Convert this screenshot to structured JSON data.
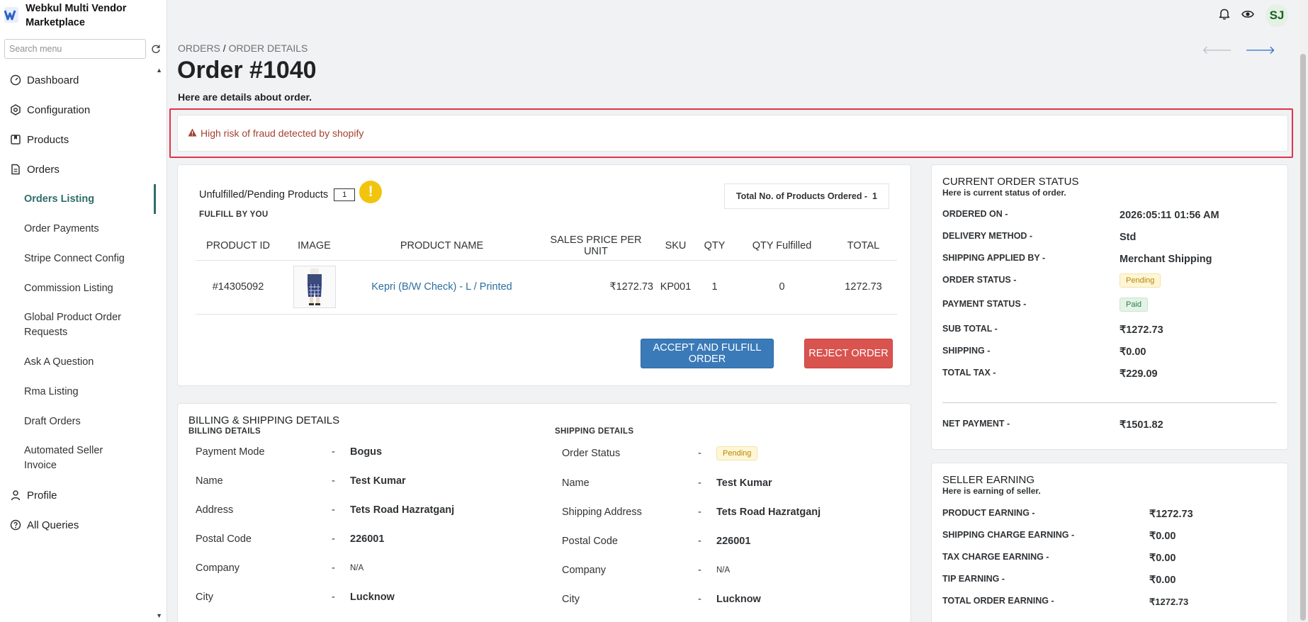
{
  "app": {
    "name": "Webkul Multi Vendor Marketplace"
  },
  "sidebar": {
    "search_placeholder": "Search menu",
    "items": [
      {
        "label": "Dashboard"
      },
      {
        "label": "Configuration"
      },
      {
        "label": "Products"
      },
      {
        "label": "Orders"
      }
    ],
    "orders_sub": [
      {
        "label": "Orders Listing"
      },
      {
        "label": "Order Payments"
      },
      {
        "label": "Stripe Connect Config"
      },
      {
        "label": "Commission Listing"
      },
      {
        "label": "Global Product Order Requests"
      },
      {
        "label": "Ask A Question"
      },
      {
        "label": "Rma Listing"
      },
      {
        "label": "Draft Orders"
      },
      {
        "label": "Automated Seller Invoice"
      }
    ],
    "bottom_items": [
      {
        "label": "Profile"
      },
      {
        "label": "All Queries"
      }
    ]
  },
  "topbar": {
    "avatar_initials": "SJ"
  },
  "breadcrumb": {
    "parent": "ORDERS",
    "separator": "/",
    "current": "ORDER DETAILS"
  },
  "page": {
    "title": "Order #1040",
    "subtitle": "Here are details about order."
  },
  "alert": {
    "text": "High risk of fraud detected by shopify"
  },
  "products_card": {
    "unfulfilled_label": "Unfulfilled/Pending Products",
    "unfulfilled_count": "1",
    "fulfill_by": "FULFILL BY YOU",
    "total_label": "Total No. of Products Ordered -",
    "total_value": "1",
    "columns": [
      "PRODUCT ID",
      "IMAGE",
      "PRODUCT NAME",
      "SALES PRICE PER UNIT",
      "SKU",
      "QTY",
      "QTY Fulfilled",
      "TOTAL"
    ],
    "rows": [
      {
        "product_id": "#14305092",
        "name": "Kepri (B/W Check) - L / Printed",
        "price": "₹1272.73",
        "sku": "KP001",
        "qty": "1",
        "qty_fulfilled": "0",
        "total": "1272.73"
      }
    ],
    "accept_label": "ACCEPT AND FULFILL ORDER",
    "reject_label": "REJECT ORDER"
  },
  "status_card": {
    "title": "CURRENT ORDER STATUS",
    "subtitle": "Here is current status of order.",
    "rows": [
      {
        "label": "ORDERED ON -",
        "value": "2026:05:11 01:56 AM"
      },
      {
        "label": "DELIVERY METHOD -",
        "value": "Std"
      },
      {
        "label": "SHIPPING APPLIED BY -",
        "value": "Merchant Shipping"
      },
      {
        "label": "ORDER STATUS -",
        "value": "Pending"
      },
      {
        "label": "PAYMENT STATUS -",
        "value": "Paid"
      },
      {
        "label": "SUB TOTAL -",
        "value": "₹1272.73"
      },
      {
        "label": "SHIPPING -",
        "value": "₹0.00"
      },
      {
        "label": "TOTAL TAX -",
        "value": "₹229.09"
      }
    ],
    "net_label": "NET PAYMENT -",
    "net_value": "₹1501.82"
  },
  "billing_card": {
    "title": "BILLING & SHIPPING DETAILS",
    "billing_head": "BILLING DETAILS",
    "shipping_head": "SHIPPING DETAILS",
    "dash": "-",
    "billing": [
      {
        "label": "Payment Mode",
        "value": "Bogus"
      },
      {
        "label": "Name",
        "value": "Test Kumar"
      },
      {
        "label": "Address",
        "value": "Tets Road Hazratganj"
      },
      {
        "label": "Postal Code",
        "value": "226001"
      },
      {
        "label": "Company",
        "value": "N/A"
      },
      {
        "label": "City",
        "value": "Lucknow"
      }
    ],
    "shipping": [
      {
        "label": "Order Status",
        "value": "Pending"
      },
      {
        "label": "Name",
        "value": "Test Kumar"
      },
      {
        "label": "Shipping Address",
        "value": "Tets Road Hazratganj"
      },
      {
        "label": "Postal Code",
        "value": "226001"
      },
      {
        "label": "Company",
        "value": "N/A"
      },
      {
        "label": "City",
        "value": "Lucknow"
      }
    ]
  },
  "earning_card": {
    "title": "SELLER EARNING",
    "subtitle": "Here is earning of seller.",
    "rows": [
      {
        "label": "PRODUCT EARNING -",
        "value": "₹1272.73"
      },
      {
        "label": "SHIPPING CHARGE EARNING -",
        "value": "₹0.00"
      },
      {
        "label": "TAX CHARGE EARNING -",
        "value": "₹0.00"
      },
      {
        "label": "TIP EARNING -",
        "value": "₹0.00"
      },
      {
        "label": "TOTAL ORDER EARNING -",
        "value": "₹1272.73"
      }
    ]
  },
  "colors": {
    "accent": "#2c6e6a",
    "link": "#2c6e9e",
    "alert_border": "#e0324a",
    "alert_text": "#a34232",
    "accept": "#3a7ab8",
    "reject": "#d9534f"
  },
  "icons": [
    "webkul-logo-icon",
    "refresh-icon",
    "dashboard-icon",
    "gear-icon",
    "book-icon",
    "document-icon",
    "person-icon",
    "question-icon",
    "bell-icon",
    "eye-icon",
    "arrow-left-icon",
    "arrow-right-icon",
    "warning-icon",
    "exclamation-icon"
  ]
}
